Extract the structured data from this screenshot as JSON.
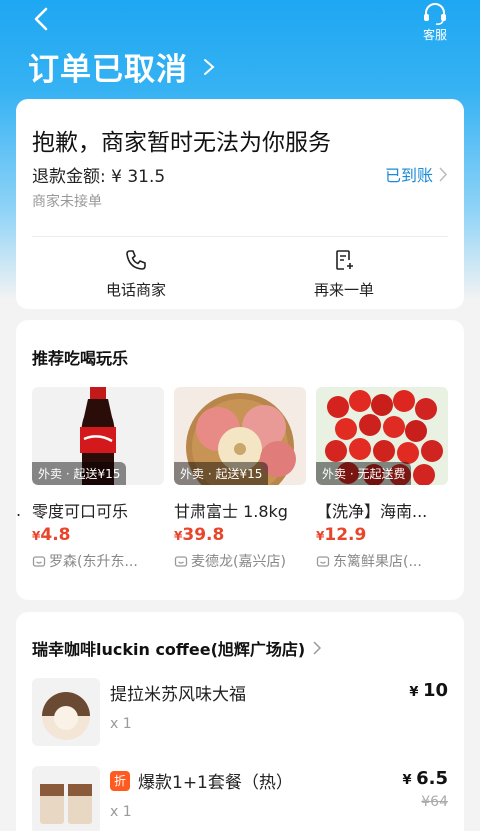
{
  "header": {
    "title": "订单已取消",
    "service_label": "客服"
  },
  "status_card": {
    "headline": "抱歉，商家暂时无法为你服务",
    "refund_amount": "退款金额: ¥ 31.5",
    "refund_status": "已到账",
    "reason": "商家未接单",
    "actions": [
      {
        "label": "电话商家",
        "icon": "phone-icon"
      },
      {
        "label": "再来一单",
        "icon": "reorder-icon"
      }
    ]
  },
  "recommend": {
    "title": "推荐吃喝玩乐",
    "items": [
      {
        "tag": "外卖 · 起送¥15",
        "name": "零度可口可乐",
        "price": "4.8",
        "shop": "罗森(东升东..."
      },
      {
        "tag": "外卖 · 起送¥15",
        "name": "甘肃富士 1.8kg",
        "price": "39.8",
        "shop": "麦德龙(嘉兴店)"
      },
      {
        "tag": "外卖 · 无起送费",
        "name": "【洗净】海南...",
        "price": "12.9",
        "shop": "东篱鲜果店(..."
      }
    ]
  },
  "order": {
    "store": "瑞幸咖啡luckin coffee(旭辉广场店)",
    "items": [
      {
        "name": "提拉米苏风味大福",
        "qty": "x 1",
        "price": "10",
        "original_price": "",
        "discount_badge": ""
      },
      {
        "name": "爆款1+1套餐（热）",
        "qty": "x 1",
        "price": "6.5",
        "original_price": "¥64",
        "discount_badge": "折"
      }
    ]
  },
  "colors": {
    "accent": "#1ea7f2",
    "price": "#e8452b",
    "link": "#1a8bd8"
  }
}
